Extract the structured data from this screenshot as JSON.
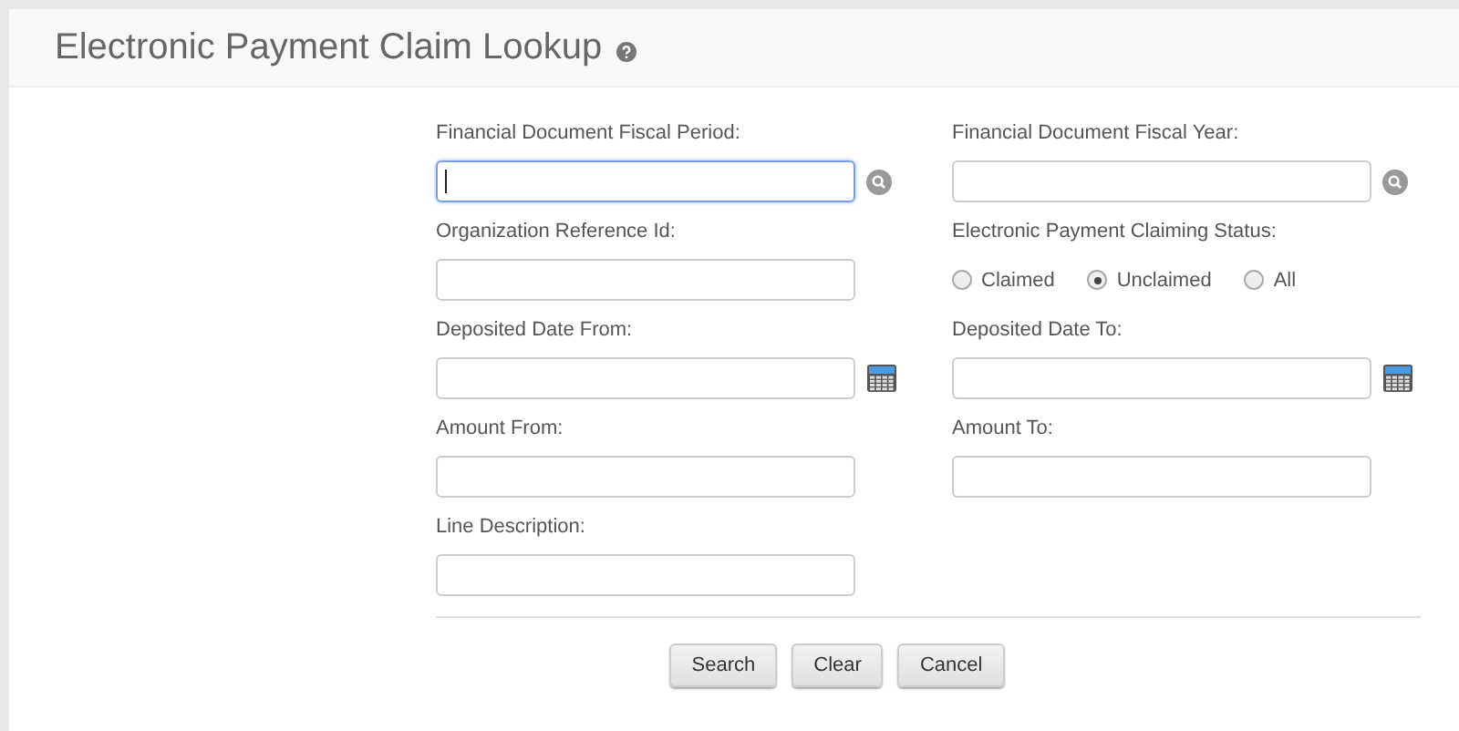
{
  "page": {
    "title": "Electronic Payment Claim Lookup"
  },
  "fields": [
    {
      "kind": "lookup",
      "label": "Financial Document Fiscal Period:",
      "focused": true
    },
    {
      "kind": "lookup",
      "label": "Financial Document Fiscal Year:",
      "focused": false
    },
    {
      "kind": "text",
      "label": "Organization Reference Id:",
      "focused": false
    },
    {
      "kind": "radio",
      "label": "Electronic Payment Claiming Status:",
      "options": [
        {
          "label": "Claimed",
          "selected": false
        },
        {
          "label": "Unclaimed",
          "selected": true
        },
        {
          "label": "All",
          "selected": false
        }
      ]
    },
    {
      "kind": "date",
      "label": "Deposited Date From:",
      "focused": false
    },
    {
      "kind": "date",
      "label": "Deposited Date To:",
      "focused": false
    },
    {
      "kind": "text",
      "label": "Amount From:",
      "focused": false
    },
    {
      "kind": "text",
      "label": "Amount To:",
      "focused": false
    },
    {
      "kind": "text",
      "label": "Line Description:",
      "focused": false
    }
  ],
  "buttons": [
    "Search",
    "Clear",
    "Cancel"
  ]
}
